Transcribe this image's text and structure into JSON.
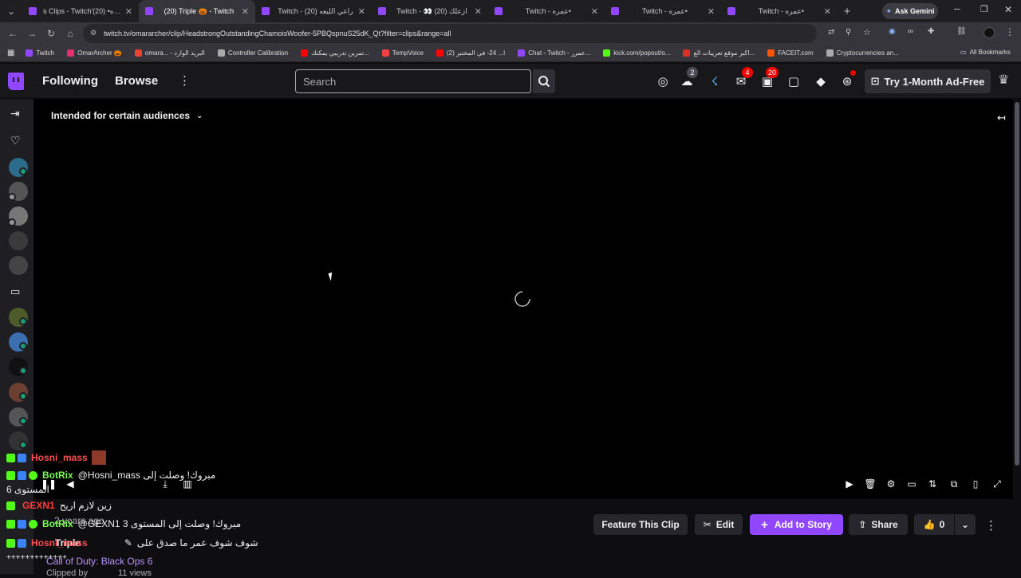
{
  "browser": {
    "tabs": [
      {
        "label": "s Clips - Twitch'عمره• (20)"
      },
      {
        "label": "(20) Triple 🎃 - Twitch"
      },
      {
        "label": "Twitch - راعي الليعه (20)"
      },
      {
        "label": "Twitch - 👀 ازعلك (20)"
      },
      {
        "label": "Twitch - عمره•"
      },
      {
        "label": "Twitch - عمره•"
      },
      {
        "label": "Twitch - عمره•"
      }
    ],
    "ask_gemini": "Ask Gemini",
    "url": "twitch.tv/omararcher/clip/HeadstrongOutstandingChamoisWoofer-5PBQspnuS25dK_Qt?filter=clips&range=all",
    "bookmarks": [
      {
        "label": "Twitch",
        "color": "#9147ff"
      },
      {
        "label": "OmarArcher 🎃",
        "color": "#e1306c"
      },
      {
        "label": "omara... - البريد الوارد",
        "color": "#ea4335"
      },
      {
        "label": "Controller Calibration",
        "color": "#aaaaaa"
      },
      {
        "label": "تمرين تدريبي يمكنك...",
        "color": "#ff0000"
      },
      {
        "label": "TempVoice",
        "color": "#ed4245"
      },
      {
        "label": "ا... 24- في المختبر (2)",
        "color": "#ff0000"
      },
      {
        "label": "Chat - Twitch - عمرر...",
        "color": "#9147ff"
      },
      {
        "label": "kick.com/popout/o...",
        "color": "#53fc18"
      },
      {
        "label": "اكبر موقع تعريبات الع...",
        "color": "#d93025"
      },
      {
        "label": "FACEIT.com",
        "color": "#ff5500"
      },
      {
        "label": "Cryptocurrencies an...",
        "color": "#aaaaaa"
      }
    ],
    "all_bookmarks": "All Bookmarks"
  },
  "nav": {
    "following": "Following",
    "browse": "Browse",
    "search_placeholder": "Search",
    "badge_friends": "2",
    "badge_whispers": "4",
    "badge_notifications": "20",
    "ad_free": "Try 1-Month Ad-Free"
  },
  "player": {
    "audience_label": "Intended for certain audiences"
  },
  "chat": [
    {
      "user": "Hosni_mass",
      "user_color": "#ff4f4f",
      "text": ""
    },
    {
      "user": "BotRix",
      "user_color": "#79ff4d",
      "text": "@Hosni_mass مبروك! وصلت إلى"
    },
    {
      "user": "",
      "user_color": "#ffffff",
      "text": "المستوى 6"
    },
    {
      "user": "GEXN1",
      "user_color": "#ff3c3c",
      "text": "زين لازم اريح"
    },
    {
      "user": "BotRix",
      "user_color": "#79ff4d",
      "text": "@GEXN1 مبروك! وصلت إلى المستوى 3"
    },
    {
      "user": "Hosni_mass",
      "user_color": "#ff4f4f",
      "text": "شوف شوف عمر ما صدق على"
    },
    {
      "user": "",
      "user_color": "#ffffff",
      "text": "+++++++++++++"
    }
  ],
  "clip": {
    "time_ago": "2 years ago",
    "channel": "Triple",
    "game": "Call of Duty: Black Ops 6",
    "clipped_by": "Clipped by",
    "views": "11 views"
  },
  "actions": {
    "feature": "Feature This Clip",
    "edit": "Edit",
    "add_story": "Add to Story",
    "share": "Share",
    "likes": "0"
  },
  "colors": {
    "twitch_purple": "#9147ff",
    "live_green": "#1b9e77"
  }
}
